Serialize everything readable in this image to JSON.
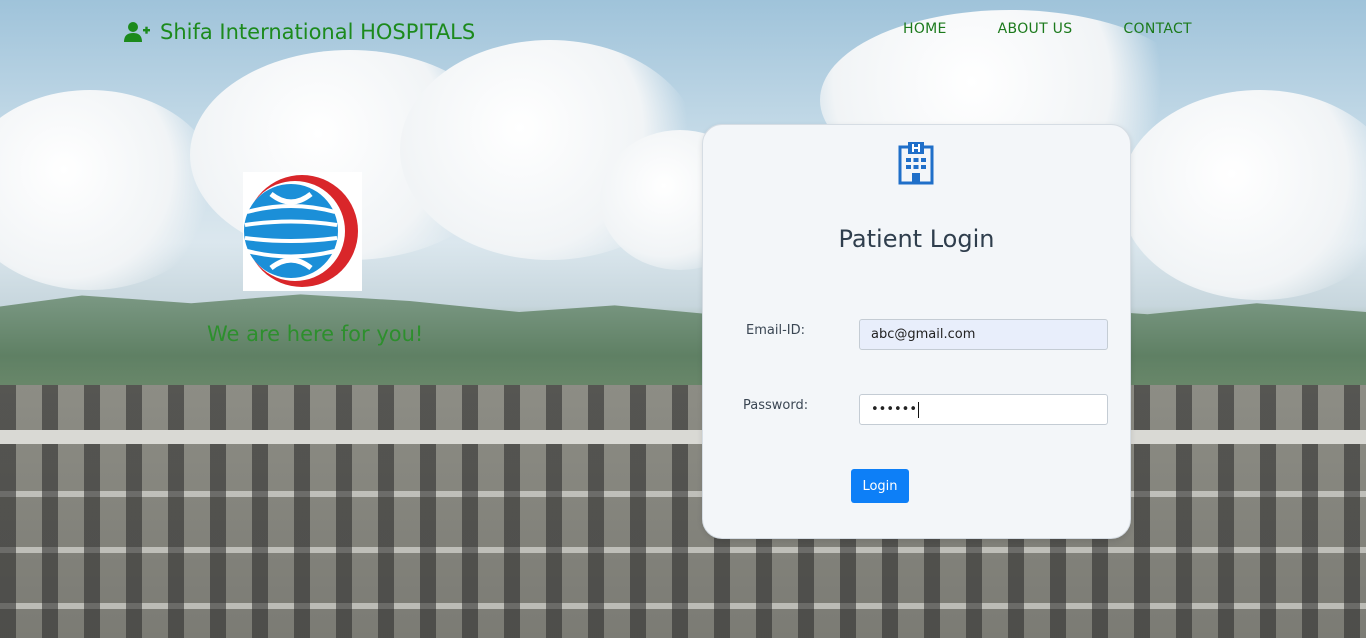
{
  "brand": {
    "icon": "user-plus-icon",
    "name": "Shifa International HOSPITALS",
    "color": "#1c8a1c"
  },
  "nav": {
    "items": [
      {
        "label": "HOME"
      },
      {
        "label": "ABOUT US"
      },
      {
        "label": "CONTACT"
      }
    ]
  },
  "hero": {
    "logo": "hospital-globe-logo",
    "tagline": "We are here for you!"
  },
  "login": {
    "icon": "hospital-building-icon",
    "title": "Patient Login",
    "email_label": "Email-ID:",
    "email_value": "abc@gmail.com",
    "password_label": "Password:",
    "password_value": "••••••",
    "button_label": "Login",
    "button_color": "#0d7ff7"
  }
}
